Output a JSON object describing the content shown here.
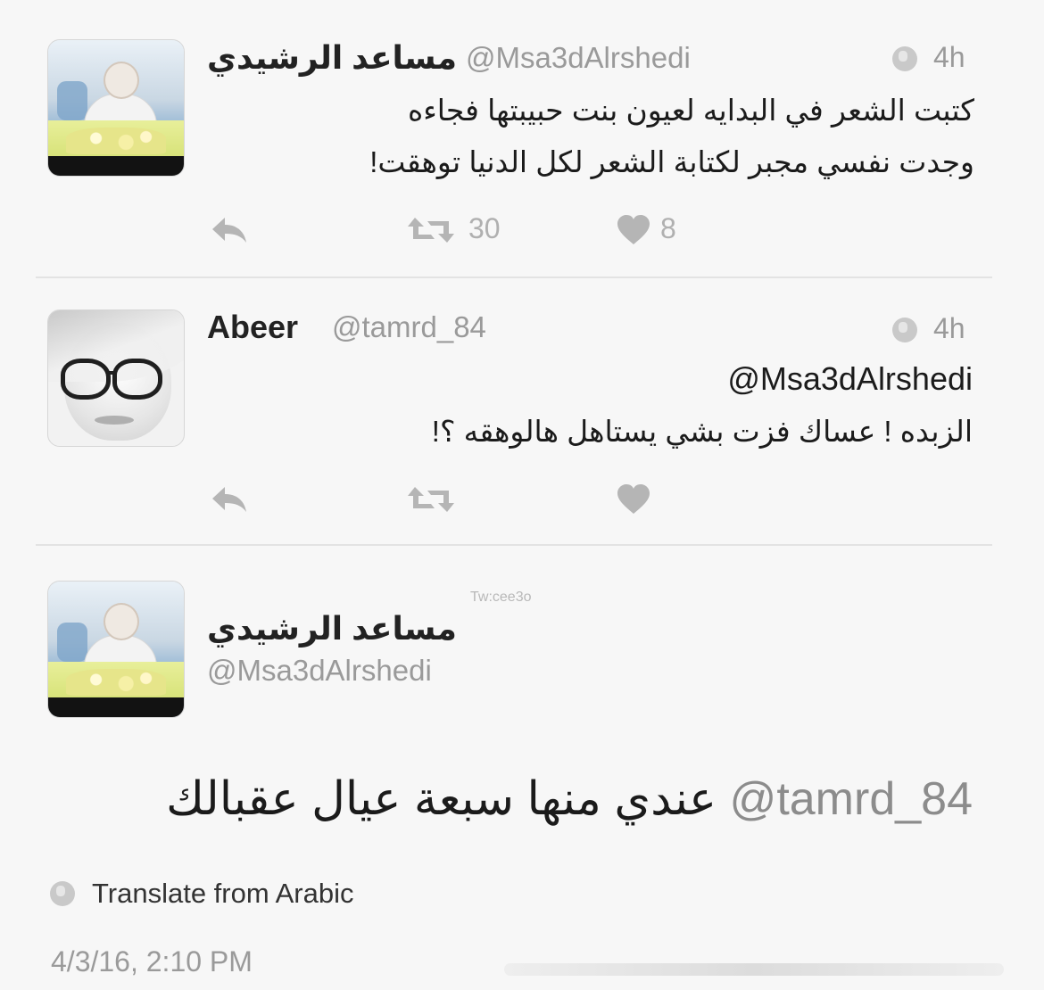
{
  "tweets": [
    {
      "name": "مساعد الرشيدي",
      "handle": "@Msa3dAlrshedi",
      "time": "4h",
      "lines": [
        "كتبت الشعر في البدايه  لعيون  بنت حبيبتها  فجاءه",
        "وجدت نفسي مجبر لكتابة الشعر لكل الدنيا توهقت!"
      ],
      "retweets": "30",
      "likes": "8"
    },
    {
      "name": "Abeer",
      "handle": "@tamrd_84",
      "time": "4h",
      "mention": "@Msa3dAlrshedi",
      "line": "الزبده ! عساك فزت بشي يستاهل هالوهقه  ؟!"
    }
  ],
  "detail": {
    "name": "مساعد الرشيدي",
    "handle": "@Msa3dAlrshedi",
    "mention": "@tamrd_84",
    "text": "عندي منها سبعة عيال عقبالك",
    "translate": "Translate from Arabic",
    "date": "4/3/16, 2:10 PM"
  },
  "watermark": "Tw:cee3o",
  "icons": [
    "reply-icon",
    "retweet-icon",
    "heart-icon",
    "globe-icon"
  ]
}
